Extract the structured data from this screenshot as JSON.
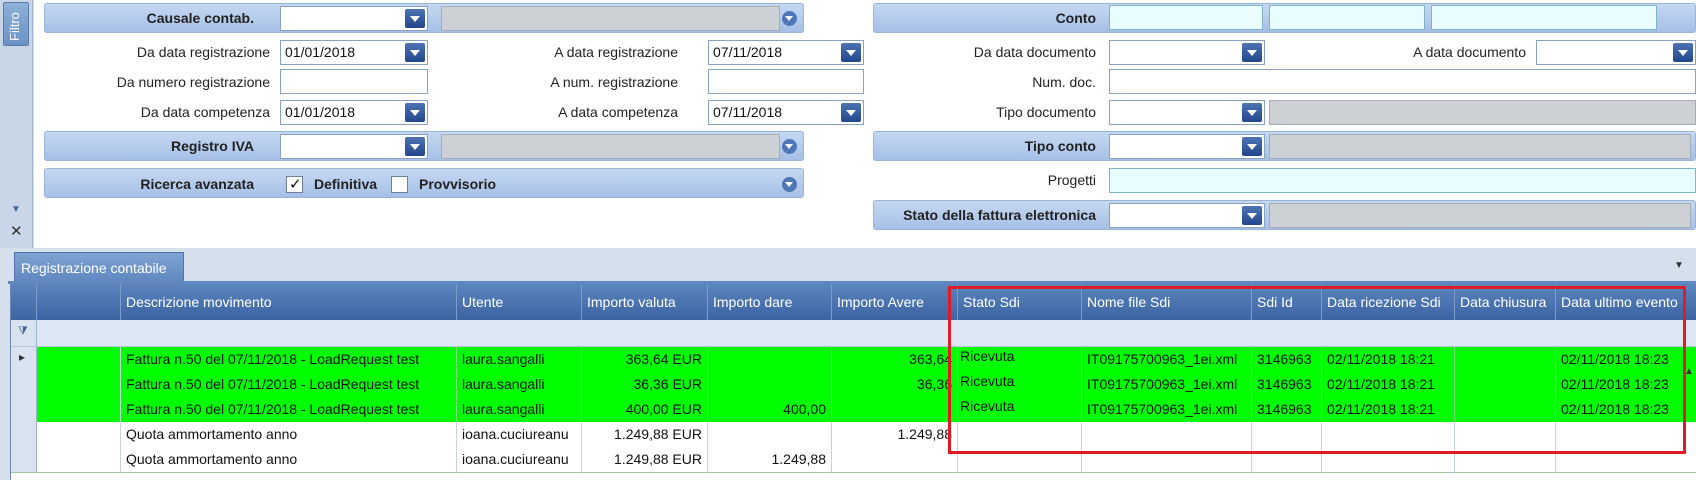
{
  "sidebar": {
    "filter_tab": "Filtro"
  },
  "filter": {
    "causale_label": "Causale contab.",
    "conto_label": "Conto",
    "da_data_reg_label": "Da data registrazione",
    "da_data_reg_value": "01/01/2018",
    "a_data_reg_label": "A data registrazione",
    "a_data_reg_value": "07/11/2018",
    "da_data_doc_label": "Da data documento",
    "a_data_doc_label": "A data documento",
    "da_num_reg_label": "Da numero registrazione",
    "a_num_reg_label": "A num. registrazione",
    "num_doc_label": "Num. doc.",
    "da_data_comp_label": "Da data competenza",
    "da_data_comp_value": "01/01/2018",
    "a_data_comp_label": "A data competenza",
    "a_data_comp_value": "07/11/2018",
    "tipo_doc_label": "Tipo documento",
    "registro_iva_label": "Registro IVA",
    "tipo_conto_label": "Tipo conto",
    "ricerca_label": "Ricerca avanzata",
    "definitiva_label": "Definitiva",
    "definitiva_checked": true,
    "provvisorio_label": "Provvisorio",
    "provvisorio_checked": false,
    "progetti_label": "Progetti",
    "stato_fe_label": "Stato della fattura elettronica"
  },
  "tab": {
    "label": "Registrazione contabile"
  },
  "grid": {
    "columns": [
      "Descrizione movimento",
      "Utente",
      "Importo valuta",
      "Importo dare",
      "Importo Avere",
      "Stato Sdi",
      "Nome file Sdi",
      "Sdi Id",
      "Data ricezione Sdi",
      "Data chiusura",
      "Data ultimo evento"
    ],
    "rows": [
      {
        "desc": "Fattura n.50 del 07/11/2018 - LoadRequest test",
        "utente": "laura.sangalli",
        "valuta": "363,64 EUR",
        "dare": "",
        "avere": "363,64",
        "stato": "Ricevuta",
        "file": "IT09175700963_1ei.xml",
        "sdi": "3146963",
        "ricezione": "02/11/2018 18:21",
        "chiusura": "",
        "ultimo": "02/11/2018 18:23",
        "highlight": true
      },
      {
        "desc": "Fattura n.50 del 07/11/2018 - LoadRequest test",
        "utente": "laura.sangalli",
        "valuta": "36,36 EUR",
        "dare": "",
        "avere": "36,36",
        "stato": "Ricevuta",
        "file": "IT09175700963_1ei.xml",
        "sdi": "3146963",
        "ricezione": "02/11/2018 18:21",
        "chiusura": "",
        "ultimo": "02/11/2018 18:23",
        "highlight": true
      },
      {
        "desc": "Fattura n.50 del 07/11/2018 - LoadRequest test",
        "utente": "laura.sangalli",
        "valuta": "400,00 EUR",
        "dare": "400,00",
        "avere": "",
        "stato": "Ricevuta",
        "file": "IT09175700963_1ei.xml",
        "sdi": "3146963",
        "ricezione": "02/11/2018 18:21",
        "chiusura": "",
        "ultimo": "02/11/2018 18:23",
        "highlight": true
      },
      {
        "desc": "Quota ammortamento anno",
        "utente": "ioana.cuciureanu",
        "valuta": "1.249,88 EUR",
        "dare": "",
        "avere": "1.249,88",
        "stato": "",
        "file": "",
        "sdi": "",
        "ricezione": "",
        "chiusura": "",
        "ultimo": "",
        "highlight": false
      },
      {
        "desc": "Quota ammortamento anno",
        "utente": "ioana.cuciureanu",
        "valuta": "1.249,88 EUR",
        "dare": "1.249,88",
        "avere": "",
        "stato": "",
        "file": "",
        "sdi": "",
        "ricezione": "",
        "chiusura": "",
        "ultimo": "",
        "highlight": false
      }
    ]
  },
  "colors": {
    "highlight_row": "#00ff00",
    "annotation_box": "#e01b24",
    "header": "#3b64a3"
  }
}
